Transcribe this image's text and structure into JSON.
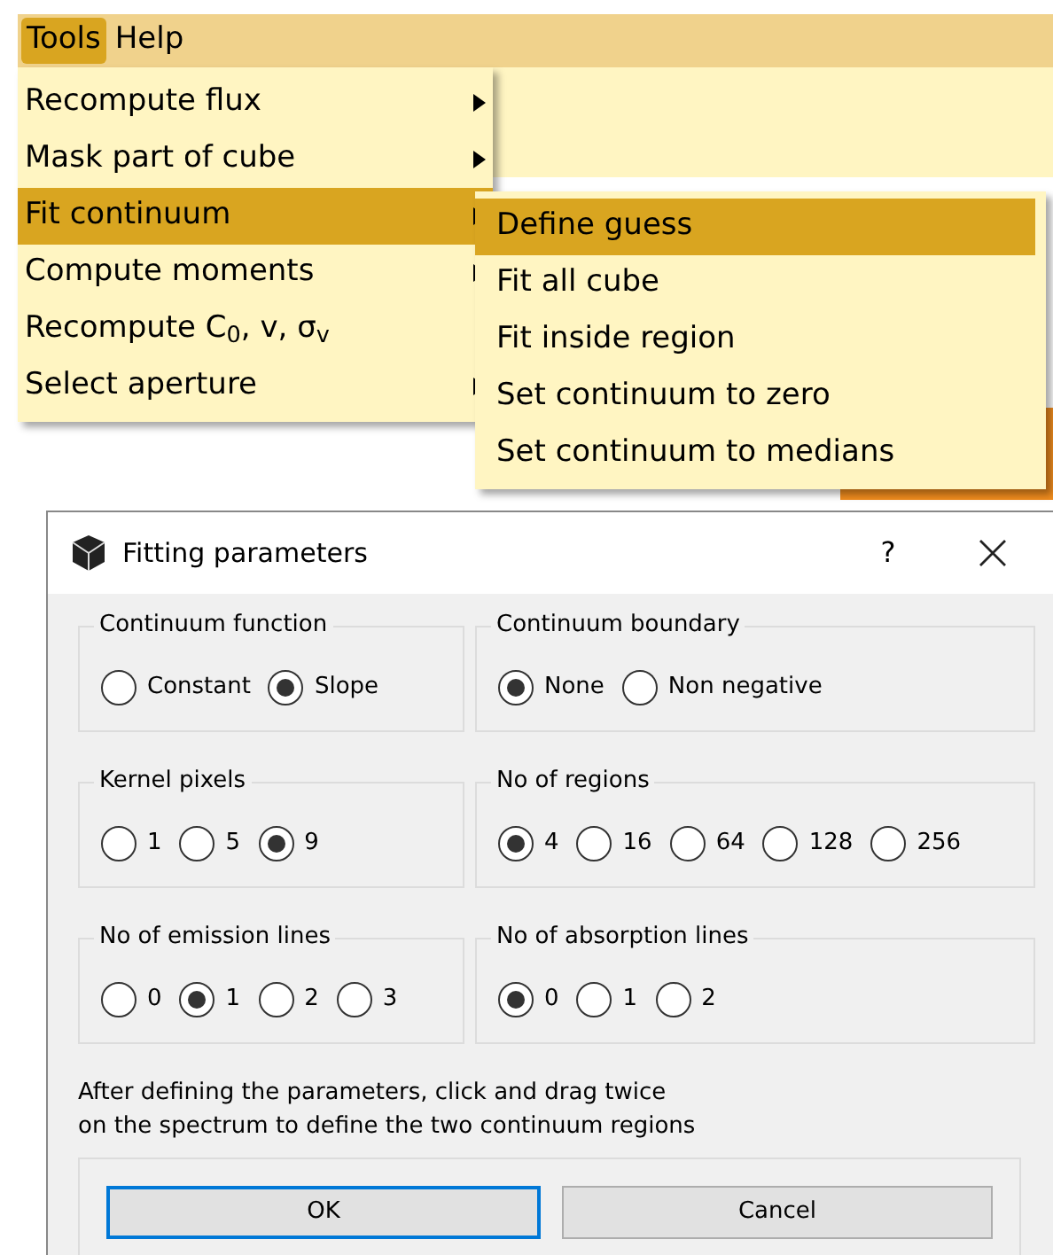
{
  "menu_bar": [
    {
      "label": "Tools",
      "selected": true
    },
    {
      "label": "Help",
      "selected": false
    }
  ],
  "tools_menu": [
    {
      "label": "Recompute flux",
      "has_submenu": true,
      "selected": false
    },
    {
      "label": "Mask part of cube",
      "has_submenu": true,
      "selected": false
    },
    {
      "label": "Fit continuum",
      "has_submenu": true,
      "selected": true
    },
    {
      "label": "Compute moments",
      "has_submenu": true,
      "selected": false
    },
    {
      "label": "Recompute C$_{0}$, v, σ$_{v}$",
      "has_submenu": false,
      "selected": false
    },
    {
      "label": "Select aperture",
      "has_submenu": true,
      "selected": false
    }
  ],
  "fit_continuum_submenu": [
    {
      "label": "Define guess",
      "selected": true
    },
    {
      "label": "Fit all cube",
      "selected": false
    },
    {
      "label": "Fit inside region",
      "selected": false
    },
    {
      "label": "Set continuum to zero",
      "selected": false
    },
    {
      "label": "Set continuum to medians",
      "selected": false
    }
  ],
  "dialog": {
    "title": "Fitting parameters",
    "help": "?",
    "groups": [
      {
        "title": "Continuum function",
        "options": [
          {
            "label": "Constant",
            "selected": false
          },
          {
            "label": "Slope",
            "selected": true
          }
        ]
      },
      {
        "title": "Continuum boundary",
        "options": [
          {
            "label": "None",
            "selected": true
          },
          {
            "label": "Non negative",
            "selected": false
          }
        ]
      },
      {
        "title": "Kernel pixels",
        "options": [
          {
            "label": "1",
            "selected": false
          },
          {
            "label": "5",
            "selected": false
          },
          {
            "label": "9",
            "selected": true
          }
        ]
      },
      {
        "title": "No of regions",
        "options": [
          {
            "label": "4",
            "selected": true
          },
          {
            "label": "16",
            "selected": false
          },
          {
            "label": "64",
            "selected": false
          },
          {
            "label": "128",
            "selected": false
          },
          {
            "label": "256",
            "selected": false
          }
        ]
      },
      {
        "title": "No of emission lines",
        "options": [
          {
            "label": "0",
            "selected": false
          },
          {
            "label": "1",
            "selected": true
          },
          {
            "label": "2",
            "selected": false
          },
          {
            "label": "3",
            "selected": false
          }
        ]
      },
      {
        "title": "No of absorption lines",
        "options": [
          {
            "label": "0",
            "selected": true
          },
          {
            "label": "1",
            "selected": false
          },
          {
            "label": "2",
            "selected": false
          }
        ]
      }
    ],
    "instructions": [
      "After defining the parameters, click and drag twice",
      "on the spectrum to define the two continuum regions"
    ],
    "buttons": [
      {
        "label": "OK",
        "focused": true
      },
      {
        "label": "Cancel",
        "focused": false
      }
    ]
  }
}
